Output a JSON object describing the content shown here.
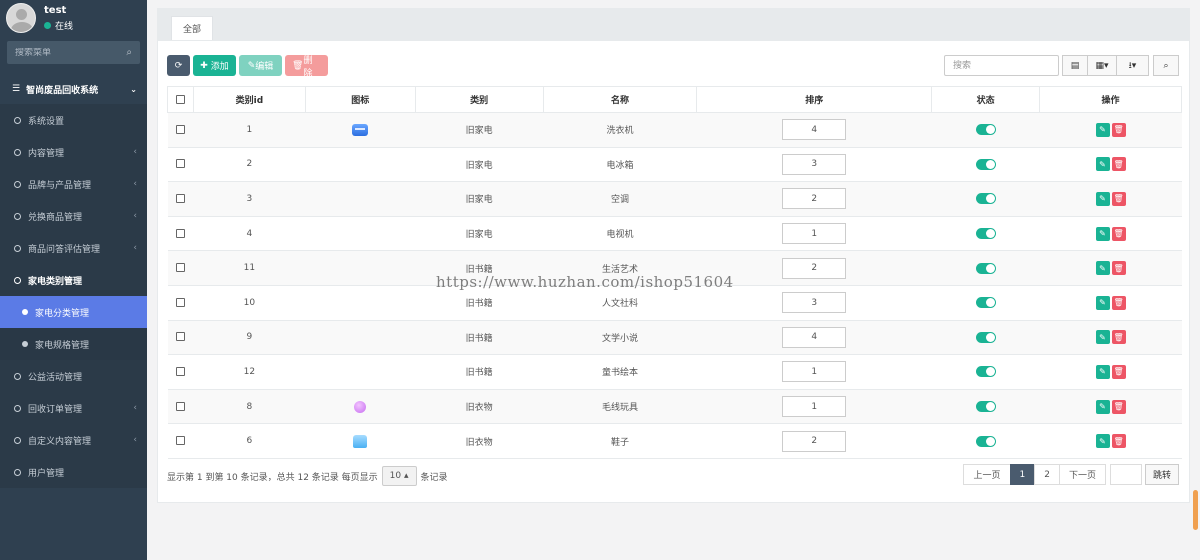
{
  "user": {
    "name": "test",
    "status": "在线"
  },
  "sidebar": {
    "search_placeholder": "搜索菜单",
    "root": "智尚废品回收系统",
    "items": [
      {
        "label": "系统设置",
        "has_children": false
      },
      {
        "label": "内容管理",
        "has_children": true
      },
      {
        "label": "品牌与产品管理",
        "has_children": true
      },
      {
        "label": "兑换商品管理",
        "has_children": true
      },
      {
        "label": "商品问答评估管理",
        "has_children": true
      },
      {
        "label": "家电类别管理",
        "has_children": true,
        "open": true
      },
      {
        "label": "公益活动管理",
        "has_children": false
      },
      {
        "label": "回收订单管理",
        "has_children": true
      },
      {
        "label": "自定义内容管理",
        "has_children": true
      },
      {
        "label": "用户管理",
        "has_children": false
      }
    ],
    "submenu": [
      {
        "label": "家电分类管理",
        "active": true
      },
      {
        "label": "家电规格管理",
        "active": false
      }
    ]
  },
  "tabs": [
    {
      "label": "全部"
    }
  ],
  "toolbar": {
    "add_label": "添加",
    "edit_label": "编辑",
    "delete_label": "删除",
    "search_placeholder": "搜索"
  },
  "table": {
    "headers": [
      "类别id",
      "图标",
      "类别",
      "名称",
      "排序",
      "状态",
      "操作"
    ],
    "rows": [
      {
        "id": "1",
        "icon": "washer-icon",
        "category": "旧家电",
        "name": "洗衣机",
        "sort": "4",
        "enabled": true
      },
      {
        "id": "2",
        "icon": "",
        "category": "旧家电",
        "name": "电冰箱",
        "sort": "3",
        "enabled": true
      },
      {
        "id": "3",
        "icon": "",
        "category": "旧家电",
        "name": "空调",
        "sort": "2",
        "enabled": true
      },
      {
        "id": "4",
        "icon": "",
        "category": "旧家电",
        "name": "电视机",
        "sort": "1",
        "enabled": true
      },
      {
        "id": "11",
        "icon": "",
        "category": "旧书籍",
        "name": "生活艺术",
        "sort": "2",
        "enabled": true
      },
      {
        "id": "10",
        "icon": "",
        "category": "旧书籍",
        "name": "人文社科",
        "sort": "3",
        "enabled": true
      },
      {
        "id": "9",
        "icon": "",
        "category": "旧书籍",
        "name": "文学小说",
        "sort": "4",
        "enabled": true
      },
      {
        "id": "12",
        "icon": "",
        "category": "旧书籍",
        "name": "童书绘本",
        "sort": "1",
        "enabled": true
      },
      {
        "id": "8",
        "icon": "plush-toy-icon",
        "category": "旧衣物",
        "name": "毛线玩具",
        "sort": "1",
        "enabled": true
      },
      {
        "id": "6",
        "icon": "shoe-icon",
        "category": "旧衣物",
        "name": "鞋子",
        "sort": "2",
        "enabled": true
      }
    ]
  },
  "footer": {
    "info_prefix": "显示第 1 到第 10 条记录，总共 12 条记录 每页显示",
    "page_size": "10",
    "info_suffix": "条记录",
    "prev": "上一页",
    "pages": [
      "1",
      "2"
    ],
    "current_page": "1",
    "next": "下一页",
    "jump": "跳转"
  },
  "watermark": "https://www.huzhan.com/ishop51604",
  "colors": {
    "accent": "#1ab394",
    "danger": "#ed5565",
    "sidebar": "#2f4050",
    "active_menu": "#5b7be6"
  }
}
